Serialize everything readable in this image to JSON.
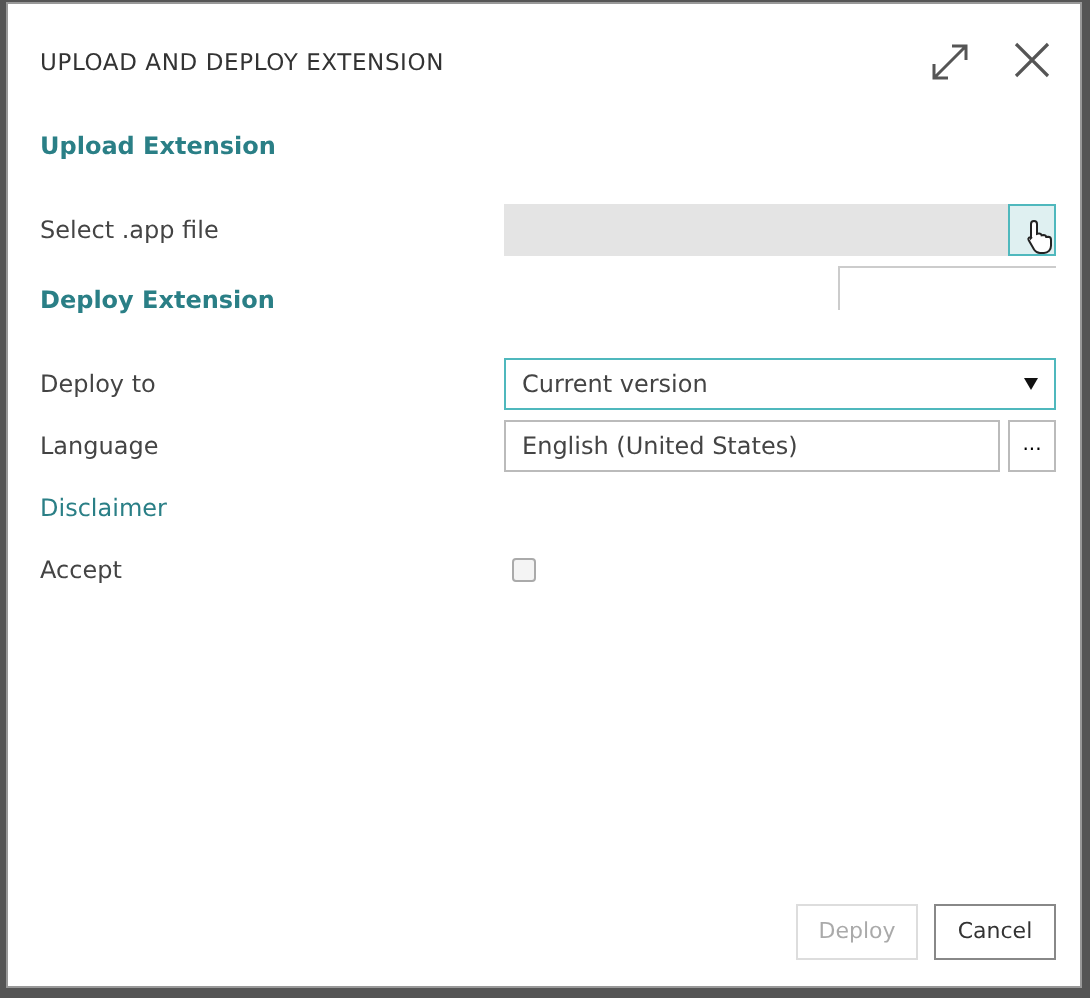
{
  "window": {
    "title": "UPLOAD AND DEPLOY EXTENSION"
  },
  "sections": [
    {
      "heading": "Upload Extension",
      "fields": [
        {
          "kind": "file",
          "label": "Select .app file"
        }
      ]
    },
    {
      "heading": "Deploy Extension",
      "fields": [
        {
          "kind": "select",
          "label": "Deploy to",
          "value": "Current version",
          "focused": true
        },
        {
          "kind": "lookup",
          "label": "Language",
          "value": "English (United States)",
          "button": "..."
        },
        {
          "kind": "link",
          "label": "Disclaimer"
        },
        {
          "kind": "checkbox",
          "label": "Accept",
          "checked": false
        }
      ]
    }
  ],
  "buttons": [
    {
      "label": "Deploy",
      "disabled": true
    },
    {
      "label": "Cancel",
      "disabled": false
    }
  ]
}
